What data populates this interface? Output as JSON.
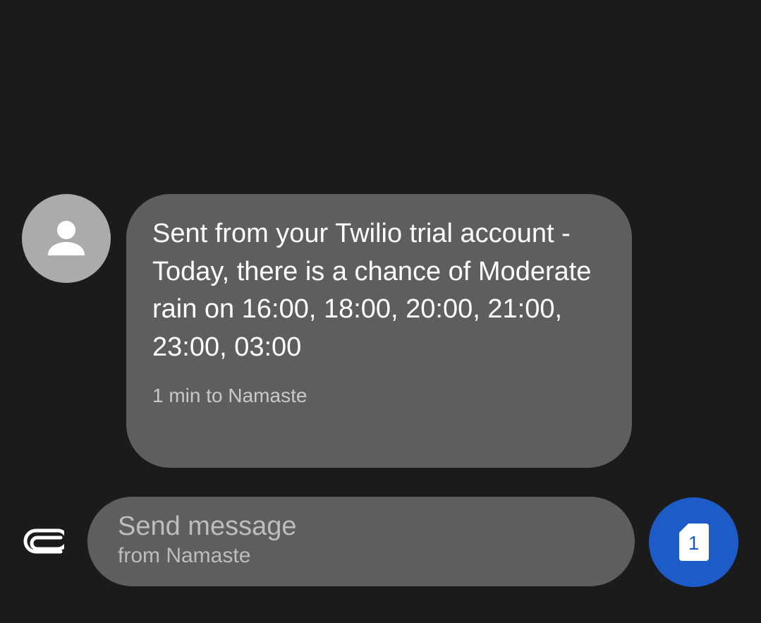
{
  "conversation": {
    "message": {
      "text": "Sent from your Twilio trial account - Today, there is a chance of Moderate rain on 16:00, 18:00, 20:00, 21:00, 23:00, 03:00",
      "meta": "1 min to Namaste",
      "avatar_icon": "person-icon"
    }
  },
  "composer": {
    "attach_icon": "paperclip-icon",
    "placeholder": "Send message",
    "sub_label": "from Namaste",
    "send_sim_number": "1",
    "send_icon": "sim-card-icon"
  },
  "colors": {
    "background": "#1b1b1b",
    "bubble": "#5e5e5e",
    "avatar": "#ababab",
    "send_button": "#1d5bc9"
  }
}
